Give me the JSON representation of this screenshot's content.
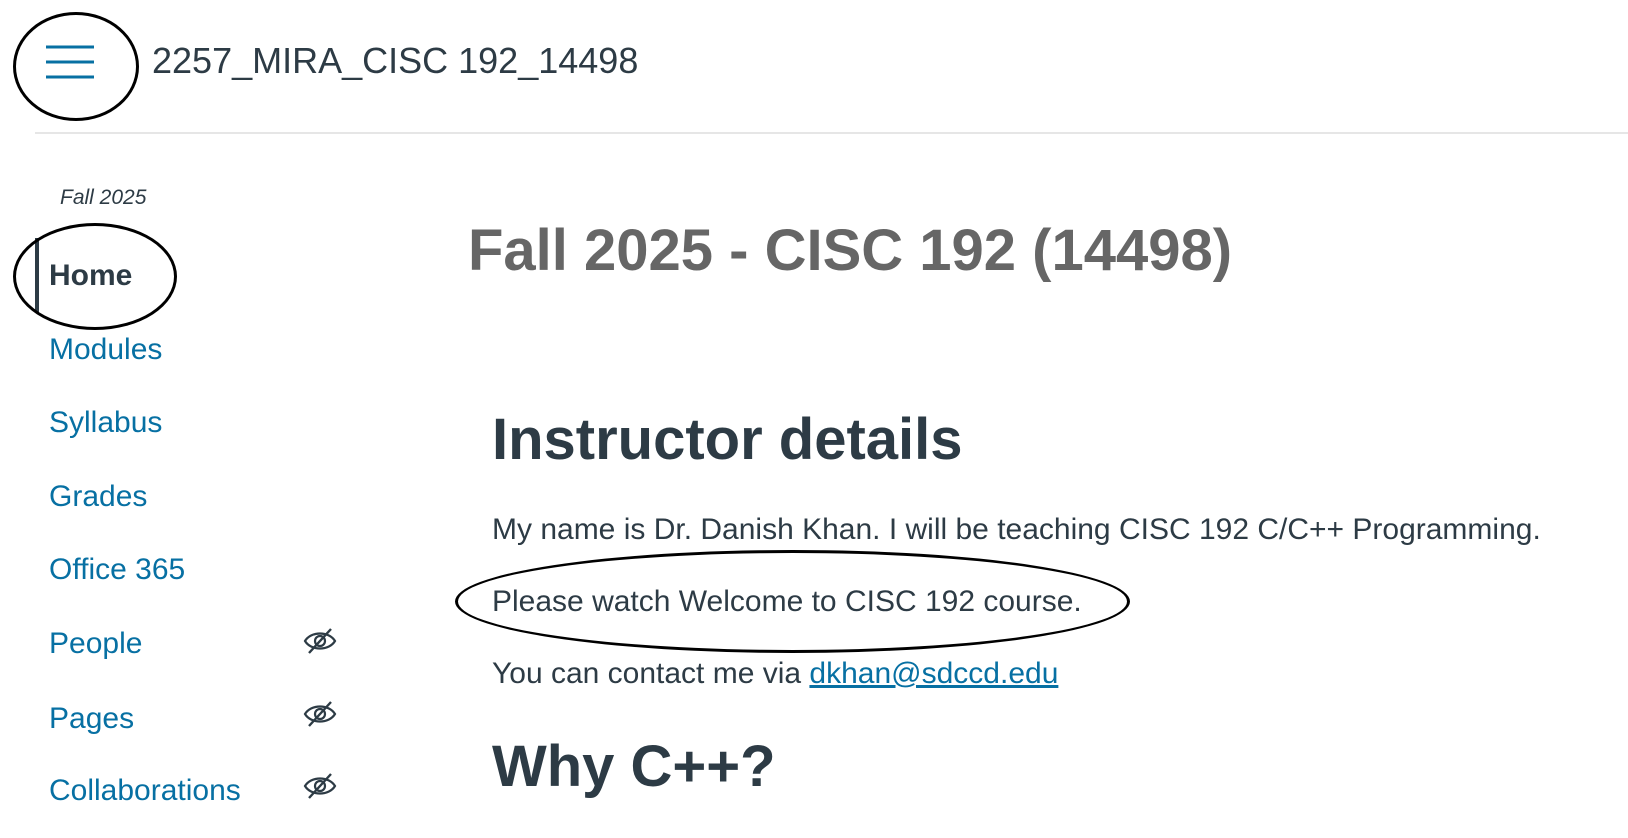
{
  "header": {
    "menu_icon": "hamburger-menu-icon",
    "course_code": "2257_MIRA_CISC 192_14498"
  },
  "sidebar": {
    "term": "Fall 2025",
    "items": [
      {
        "label": "Home",
        "active": true,
        "hidden_from_students": false
      },
      {
        "label": "Modules",
        "active": false,
        "hidden_from_students": false
      },
      {
        "label": "Syllabus",
        "active": false,
        "hidden_from_students": false
      },
      {
        "label": "Grades",
        "active": false,
        "hidden_from_students": false
      },
      {
        "label": "Office 365",
        "active": false,
        "hidden_from_students": false
      },
      {
        "label": "People",
        "active": false,
        "hidden_from_students": true
      },
      {
        "label": "Pages",
        "active": false,
        "hidden_from_students": true
      },
      {
        "label": "Collaborations",
        "active": false,
        "hidden_from_students": true
      }
    ],
    "hidden_icon": "eye-slash-icon"
  },
  "main": {
    "page_title": "Fall 2025 - CISC 192 (14498)",
    "instructor_heading": "Instructor details",
    "intro_text": "My name is Dr. Danish Khan. I will be teaching CISC 192 C/C++ Programming.",
    "watch_text": "Please watch Welcome to CISC 192 course.",
    "contact_prefix": "You can contact me via ",
    "contact_email": "dkhan@sdccd.edu",
    "why_heading": "Why C++?"
  },
  "colors": {
    "link_blue": "#0770a3",
    "text_dark": "#2d3b45",
    "title_gray": "#666666",
    "annotation_black": "#000000"
  }
}
